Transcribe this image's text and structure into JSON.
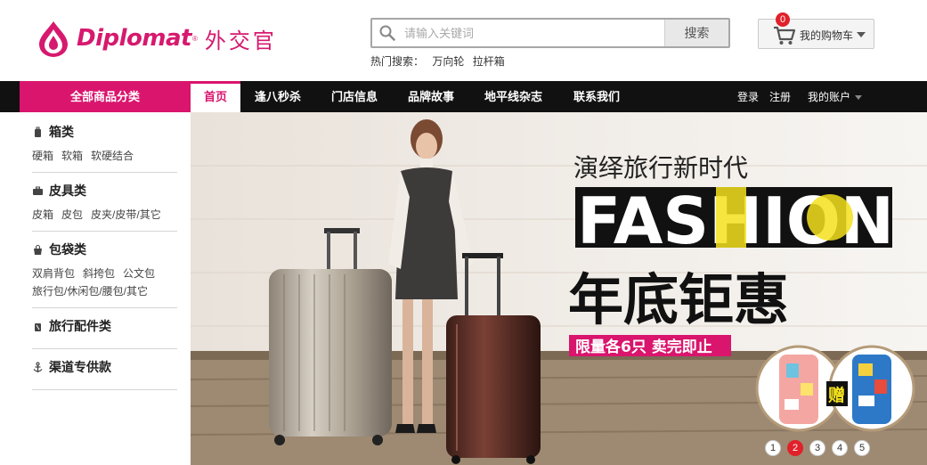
{
  "brand": {
    "name": "Diplomat",
    "reg": "®",
    "cn": "外交官",
    "color": "#d6196e"
  },
  "search": {
    "placeholder": "请输入关键词",
    "button": "搜索"
  },
  "hot_search": {
    "label": "热门搜索：",
    "keywords": [
      "万向轮",
      "拉杆箱"
    ]
  },
  "cart": {
    "count": "0",
    "label": "我的购物车"
  },
  "nav": {
    "all_categories": "全部商品分类",
    "items": [
      "首页",
      "逢八秒杀",
      "门店信息",
      "品牌故事",
      "地平线杂志",
      "联系我们"
    ],
    "active_index": 0,
    "login": "登录",
    "register": "注册",
    "account": "我的账户"
  },
  "sidebar": {
    "categories": [
      {
        "title": "箱类",
        "icon": "suitcase-icon",
        "links": [
          "硬箱",
          "软箱",
          "软硬结合"
        ]
      },
      {
        "title": "皮具类",
        "icon": "briefcase-icon",
        "links": [
          "皮箱",
          "皮包",
          "皮夹/皮带/其它"
        ]
      },
      {
        "title": "包袋类",
        "icon": "bag-icon",
        "links": [
          "双肩背包",
          "斜挎包",
          "公文包",
          "旅行包/休闲包/腰包/其它"
        ]
      },
      {
        "title": "旅行配件类",
        "icon": "accessory-icon",
        "links": []
      },
      {
        "title": "渠道专供款",
        "icon": "anchor-icon",
        "links": []
      }
    ]
  },
  "banner": {
    "headline": "演绎旅行新时代",
    "fashion": "FASHION",
    "sale": "年底钜惠",
    "limited": "限量各6只 卖完即止",
    "gift": "赠",
    "colors": {
      "accent": "#d9156d",
      "yellow": "#f3e11c"
    }
  },
  "pager": {
    "pages": [
      "1",
      "2",
      "3",
      "4",
      "5"
    ],
    "active_index": 1
  }
}
